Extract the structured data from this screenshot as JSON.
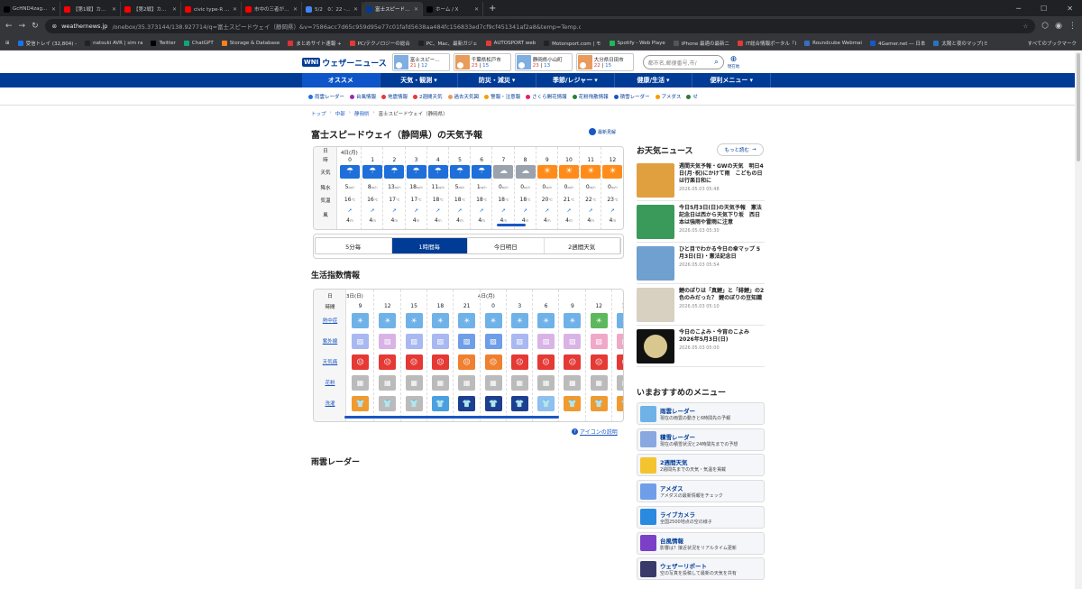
{
  "browser": {
    "tabs": [
      {
        "title": "GcHND4zagAAXwNw (2048×1",
        "color": "#000000"
      },
      {
        "title": "【第1戦】カイラード3スーパーフォーミュ",
        "color": "#ff0000"
      },
      {
        "title": "【第2戦】カイラード3スーパーフォーミュ",
        "color": "#ff0000"
      },
      {
        "title": "civic type-R モビリティーリゾートもて",
        "color": "#ff0000"
      },
      {
        "title": "市中の三者が開幕戦の予選を制す",
        "color": "#ff0000"
      },
      {
        "title": "5/2　0：22 - Google 検索",
        "color": "#4285f4"
      },
      {
        "title": "富士スピードウェイ（静岡県）の天",
        "color": "#003c96"
      },
      {
        "title": "ホーム / X",
        "color": "#000000"
      }
    ],
    "active_tab": 6,
    "url_host": "weathernews.jp",
    "url_path": "/onebox/35.373144/138.927714/q=富士スピードウェイ（静岡県）&v=7586acc7d65c959d95e77c01fafd5638aa484fc156833ed7cf9cf451341af2a8&temp=Temp.c&lang=ja?fm=header",
    "bookmarks": [
      "受信トレイ (32,804) - ",
      "natsuki AVR | sim ra",
      "Twitter",
      "ChatGPT",
      "Storage & Database",
      "まとめサイト速報 +",
      "PC/テクノロジーの総合",
      "PC、Mac、最新ガジェ",
      "AUTOSPORT web",
      "Motorsport.com | モ",
      "Spotify - Web Playe",
      "iPhone 最適の最新ニ",
      "IT総合情報ポータル「I",
      "Roundcube Webmai",
      "4Gamer.net ― 日本",
      "太陽と夜のマップ(ミ"
    ],
    "all_bookmarks": "すべてのブックマーク"
  },
  "site": {
    "logo_mark": "WNI",
    "logo_text": "ウェザーニュース",
    "cities": [
      {
        "name": "富士スピー…",
        "hi": "21",
        "lo": "12"
      },
      {
        "name": "千葉県松戸市",
        "hi": "23",
        "lo": "15"
      },
      {
        "name": "静岡県小山町",
        "hi": "23",
        "lo": "13"
      },
      {
        "name": "大分県日田市",
        "hi": "22",
        "lo": "15"
      }
    ],
    "search_placeholder": "都市名,郵便番号,市/",
    "location_label": "現在地",
    "nav": [
      "オススメ",
      "天気・観測",
      "防災・減災",
      "季節/レジャー",
      "健康/生活",
      "便利メニュー"
    ],
    "subnav": [
      "雨雲レーダー",
      "台風情報",
      "地震情報",
      "2週間天気",
      "過去天気図",
      "警報・注意報",
      "さくら開花情報",
      "花粉飛散情報",
      "積雪レーダー",
      "アメダス",
      "せ"
    ]
  },
  "page": {
    "breadcrumb": [
      "トップ",
      "中部",
      "静岡県",
      "富士スピードウェイ（静岡県）"
    ],
    "title": "富士スピードウェイ（静岡県）の天気予報",
    "latest_btn": "最新見解",
    "forecast": {
      "day_label": "4日(月)",
      "row_labels": [
        "日",
        "時",
        "天気",
        "降水",
        "気温",
        "風"
      ],
      "hours": [
        "0",
        "1",
        "2",
        "3",
        "4",
        "5",
        "6",
        "7",
        "8",
        "9",
        "10",
        "11",
        "12"
      ],
      "weather": [
        "rain",
        "rain",
        "rain",
        "rain",
        "rain",
        "rain",
        "rain",
        "cloud",
        "cloud",
        "sun",
        "sun",
        "sun",
        "sun"
      ],
      "precip": [
        "5",
        "8",
        "13",
        "18",
        "11",
        "5",
        "1",
        "0",
        "0",
        "0",
        "0",
        "0",
        "0"
      ],
      "precip_unit": "㎜/h",
      "temp": [
        "16",
        "16",
        "17",
        "17",
        "18",
        "18",
        "18",
        "18",
        "18",
        "20",
        "21",
        "22",
        "23"
      ],
      "temp_unit": "℃",
      "wind": [
        "4",
        "4",
        "4",
        "4",
        "4",
        "4",
        "4",
        "4",
        "4",
        "4",
        "4",
        "4",
        "4"
      ],
      "wind_unit": "m"
    },
    "forecast_tabs": [
      "5分毎",
      "1時間毎",
      "今日明日",
      "2週間天気"
    ],
    "forecast_tab_active": 1,
    "index_title": "生活指数情報",
    "index": {
      "day1": "3日(日)",
      "day2": "4日(月)",
      "labels": [
        "日",
        "時間",
        "熱中症",
        "紫外線",
        "天気痛",
        "花粉",
        "洗濯"
      ],
      "hours": [
        "9",
        "12",
        "15",
        "18",
        "21",
        "0",
        "3",
        "6",
        "9",
        "12",
        "15"
      ]
    },
    "help_text": "アイコンの説明",
    "radar_title": "雨雲レーダー"
  },
  "sidebar": {
    "news_title": "お天気ニュース",
    "more": "もっと読む",
    "news": [
      {
        "title": "週間天気予報・GWの天気　明日4日(月･祝)にかけて雨　こどもの日は行楽日和に",
        "date": "2026.05.03 05:48"
      },
      {
        "title": "今日5月3日(日)の天気予報　憲法記念日は西から天気下り坂　西日本は強雨や雷雨に注意",
        "date": "2026.05.03 05:30"
      },
      {
        "title": "ひと目でわかる今日の傘マップ 5月3日(日)・憲法記念日",
        "date": "2026.05.03 05:54"
      },
      {
        "title": "鯉のぼりは「真鯉」と「緋鯉」の2色のみだった？ 鯉のぼりの豆知識",
        "date": "2026.05.03 05:10"
      },
      {
        "title": "今日のこよみ・今宵のこよみ 2026年5月3日(日)",
        "date": "2026.05.03 05:00"
      }
    ],
    "menu_title": "いまおすすめのメニュー",
    "menu": [
      {
        "title": "雨雲レーダー",
        "desc": "現在の雨雲の動きと6時間先の予報"
      },
      {
        "title": "積雪レーダー",
        "desc": "現在の積雪状況と24時間先までの予想"
      },
      {
        "title": "2週間天気",
        "desc": "2週間先までの天気・気温を掲載"
      },
      {
        "title": "アメダス",
        "desc": "アメダスの最新情報をチェック"
      },
      {
        "title": "ライブカメラ",
        "desc": "全国2500地点の空の様子"
      },
      {
        "title": "台風情報",
        "desc": "影響は？接近状況をリアルタイム更新"
      },
      {
        "title": "ウェザーリポート",
        "desc": "空の写真を投稿して最新の天気を共有"
      }
    ]
  },
  "colors": {
    "brand": "#003c96",
    "rain": "#1e6fd9",
    "sun": "#ff8c1a",
    "cloud": "#9aa3ad"
  }
}
